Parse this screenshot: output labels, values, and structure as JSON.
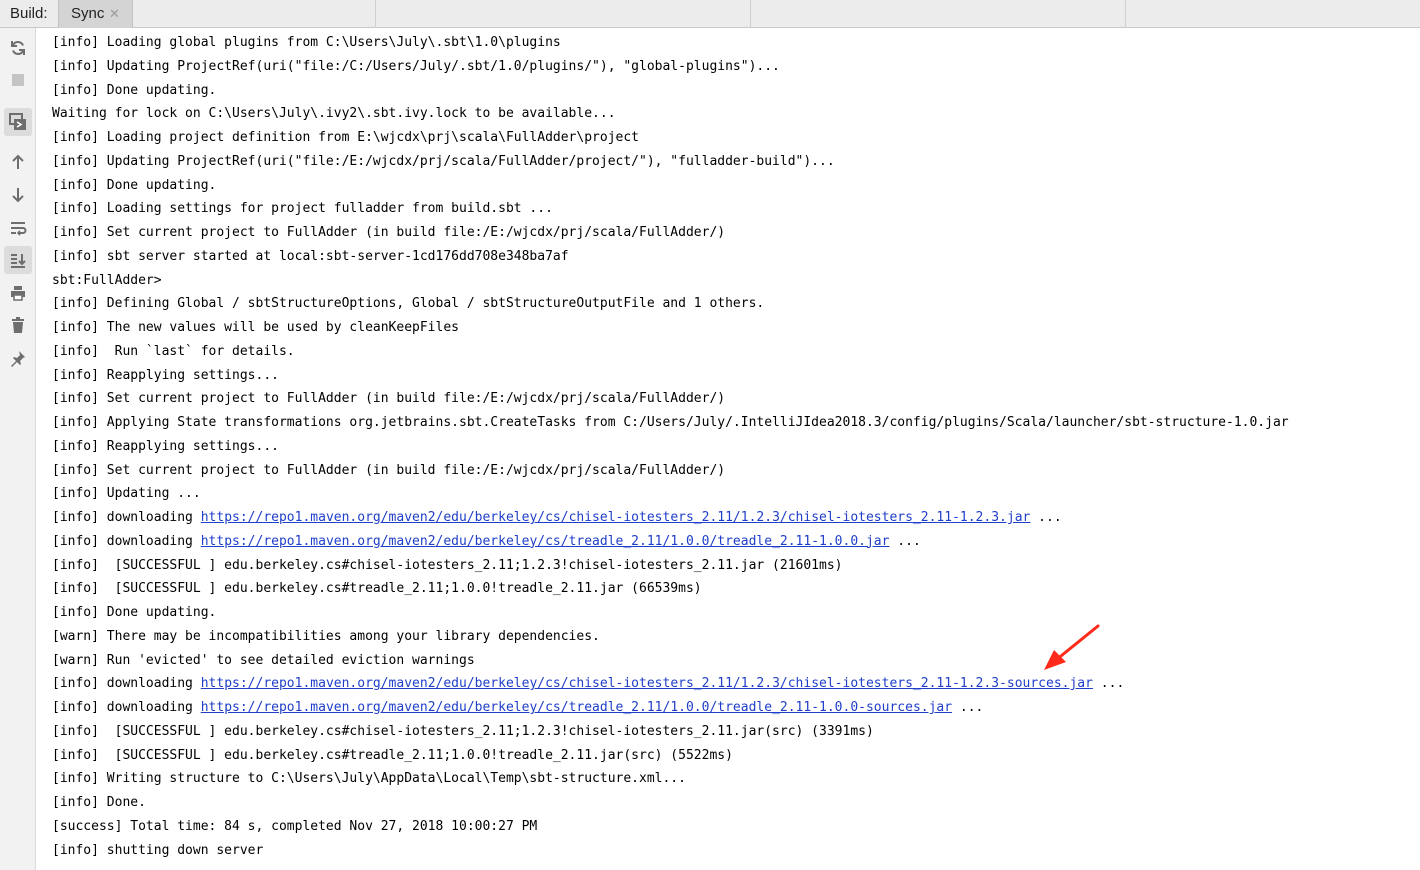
{
  "tabbar": {
    "build_label": "Build:",
    "sync_tab": "Sync",
    "close_glyph": "✕"
  },
  "toolbar_icons": [
    "refresh-icon",
    "stop-icon",
    "toggle-view-icon",
    "arrow-up-icon",
    "arrow-down-icon",
    "soft-wrap-icon",
    "scroll-to-end-icon",
    "print-icon",
    "trash-icon",
    "pin-icon"
  ],
  "colors": {
    "link": "#1f3ec9",
    "annotation_arrow": "#ff2a1a"
  },
  "console": {
    "lines": [
      {
        "text": "[info] Loading global plugins from C:\\Users\\July\\.sbt\\1.0\\plugins"
      },
      {
        "text": "[info] Updating ProjectRef(uri(\"file:/C:/Users/July/.sbt/1.0/plugins/\"), \"global-plugins\")..."
      },
      {
        "text": "[info] Done updating."
      },
      {
        "text": "Waiting for lock on C:\\Users\\July\\.ivy2\\.sbt.ivy.lock to be available..."
      },
      {
        "text": "[info] Loading project definition from E:\\wjcdx\\prj\\scala\\FullAdder\\project"
      },
      {
        "text": "[info] Updating ProjectRef(uri(\"file:/E:/wjcdx/prj/scala/FullAdder/project/\"), \"fulladder-build\")..."
      },
      {
        "text": "[info] Done updating."
      },
      {
        "text": "[info] Loading settings for project fulladder from build.sbt ..."
      },
      {
        "text": "[info] Set current project to FullAdder (in build file:/E:/wjcdx/prj/scala/FullAdder/)"
      },
      {
        "text": "[info] sbt server started at local:sbt-server-1cd176dd708e348ba7af"
      },
      {
        "text": "sbt:FullAdder>"
      },
      {
        "text": "[info] Defining Global / sbtStructureOptions, Global / sbtStructureOutputFile and 1 others."
      },
      {
        "text": "[info] The new values will be used by cleanKeepFiles"
      },
      {
        "text": "[info]  Run `last` for details."
      },
      {
        "text": "[info] Reapplying settings..."
      },
      {
        "text": "[info] Set current project to FullAdder (in build file:/E:/wjcdx/prj/scala/FullAdder/)"
      },
      {
        "text": "[info] Applying State transformations org.jetbrains.sbt.CreateTasks from C:/Users/July/.IntelliJIdea2018.3/config/plugins/Scala/launcher/sbt-structure-1.0.jar"
      },
      {
        "text": "[info] Reapplying settings..."
      },
      {
        "text": "[info] Set current project to FullAdder (in build file:/E:/wjcdx/prj/scala/FullAdder/)"
      },
      {
        "text": "[info] Updating ..."
      },
      {
        "text": "[info] downloading ",
        "link": "https://repo1.maven.org/maven2/edu/berkeley/cs/chisel-iotesters_2.11/1.2.3/chisel-iotesters_2.11-1.2.3.jar",
        "suffix": " ..."
      },
      {
        "text": "[info] downloading ",
        "link": "https://repo1.maven.org/maven2/edu/berkeley/cs/treadle_2.11/1.0.0/treadle_2.11-1.0.0.jar",
        "suffix": " ..."
      },
      {
        "text": "[info]  [SUCCESSFUL ] edu.berkeley.cs#chisel-iotesters_2.11;1.2.3!chisel-iotesters_2.11.jar (21601ms)"
      },
      {
        "text": "[info]  [SUCCESSFUL ] edu.berkeley.cs#treadle_2.11;1.0.0!treadle_2.11.jar (66539ms)"
      },
      {
        "text": "[info] Done updating."
      },
      {
        "text": "[warn] There may be incompatibilities among your library dependencies."
      },
      {
        "text": "[warn] Run 'evicted' to see detailed eviction warnings"
      },
      {
        "text": "[info] downloading ",
        "link": "https://repo1.maven.org/maven2/edu/berkeley/cs/chisel-iotesters_2.11/1.2.3/chisel-iotesters_2.11-1.2.3-sources.jar",
        "suffix": " ..."
      },
      {
        "text": "[info] downloading ",
        "link": "https://repo1.maven.org/maven2/edu/berkeley/cs/treadle_2.11/1.0.0/treadle_2.11-1.0.0-sources.jar",
        "suffix": " ..."
      },
      {
        "text": "[info]  [SUCCESSFUL ] edu.berkeley.cs#chisel-iotesters_2.11;1.2.3!chisel-iotesters_2.11.jar(src) (3391ms)"
      },
      {
        "text": "[info]  [SUCCESSFUL ] edu.berkeley.cs#treadle_2.11;1.0.0!treadle_2.11.jar(src) (5522ms)"
      },
      {
        "text": "[info] Writing structure to C:\\Users\\July\\AppData\\Local\\Temp\\sbt-structure.xml..."
      },
      {
        "text": "[info] Done."
      },
      {
        "text": "[success] Total time: 84 s, completed Nov 27, 2018 10:00:27 PM"
      },
      {
        "text": "[info] shutting down server"
      }
    ]
  }
}
